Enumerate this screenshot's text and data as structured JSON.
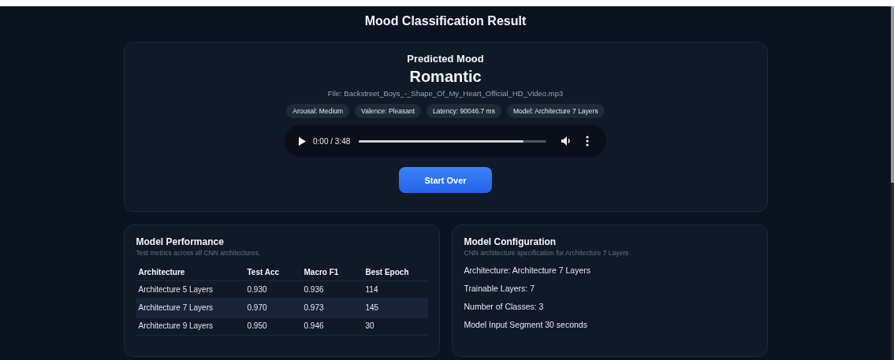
{
  "page": {
    "title": "Mood Classification Result"
  },
  "result": {
    "heading": "Predicted Mood",
    "mood": "Romantic",
    "file": "File: Backstreet_Boys_-_Shape_Of_My_Heart_Official_HD_Video.mp3",
    "tags": [
      "Arousal: Medium",
      "Valence: Pleasant",
      "Latency: 90046.7 ms",
      "Model: Architecture 7 Layers"
    ],
    "player": {
      "time": "0:00 / 3:48",
      "level": 0.88
    },
    "button": "Start Over"
  },
  "performance": {
    "title": "Model Performance",
    "subtitle": "Test metrics across all CNN architectures.",
    "columns": [
      "Architecture",
      "Test Acc",
      "Macro F1",
      "Best Epoch"
    ],
    "rows": [
      {
        "cells": [
          "Architecture 5 Layers",
          "0.930",
          "0.936",
          "114"
        ],
        "selected": false
      },
      {
        "cells": [
          "Architecture 7 Layers",
          "0.970",
          "0.973",
          "145"
        ],
        "selected": true
      },
      {
        "cells": [
          "Architecture 9 Layers",
          "0.950",
          "0.946",
          "30"
        ],
        "selected": false
      }
    ]
  },
  "configuration": {
    "title": "Model Configuration",
    "subtitle": "CNN architecture specification for Architecture 7 Layers",
    "items": [
      "Architecture: Architecture 7 Layers",
      "Trainable Layers: 7",
      "Number of Classes: 3",
      "Model Input Segment 30 seconds"
    ]
  }
}
